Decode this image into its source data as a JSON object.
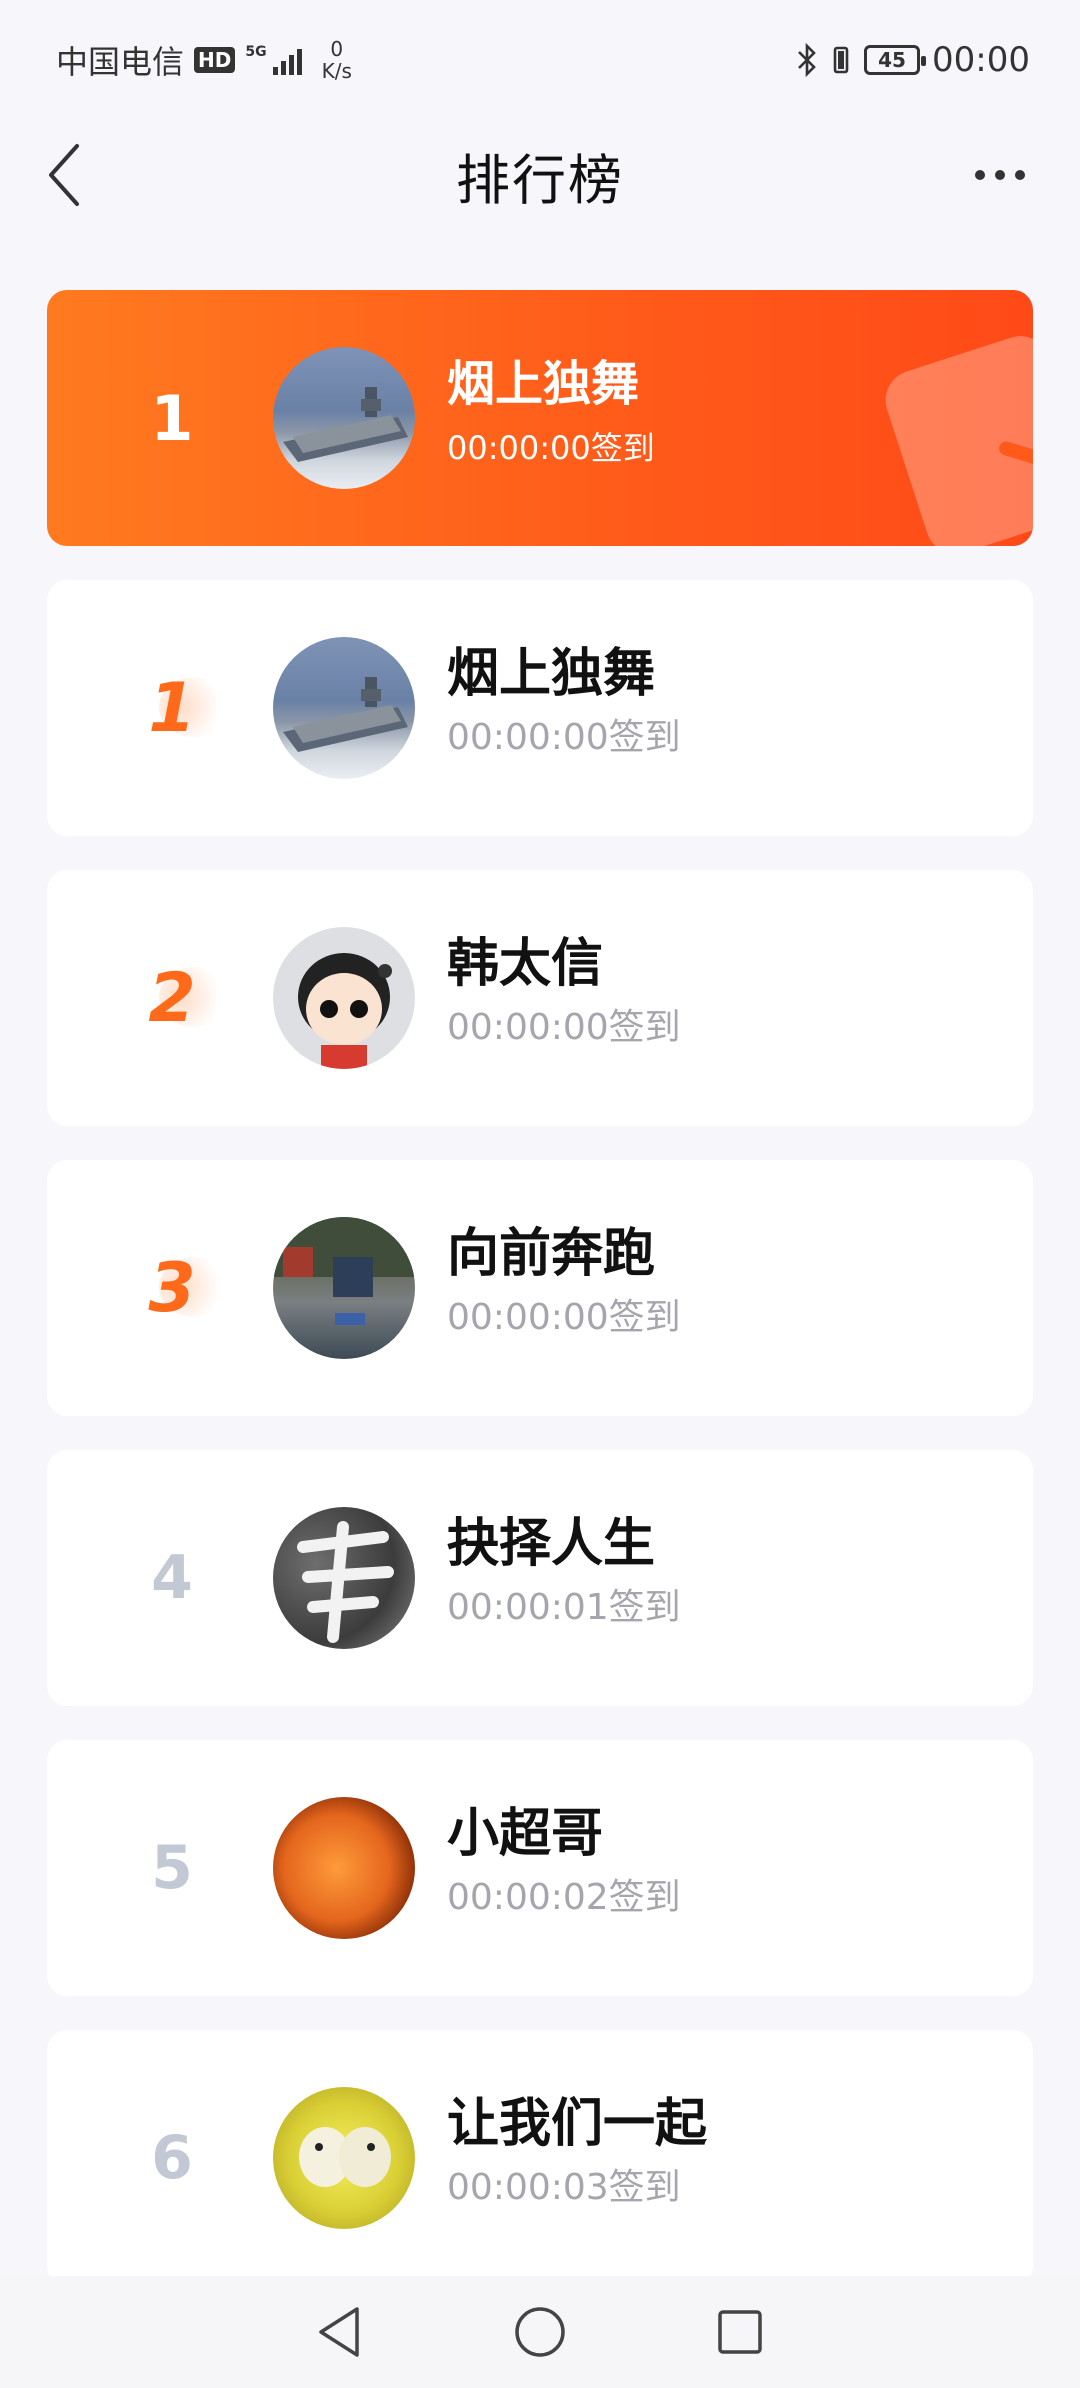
{
  "status_bar": {
    "carrier": "中国电信",
    "hd": "HD",
    "network": "5G",
    "speed_value": "0",
    "speed_unit": "K/s",
    "battery": "45",
    "time": "00:00"
  },
  "header": {
    "title": "排行榜"
  },
  "featured": {
    "rank": "1",
    "name": "烟上独舞",
    "time": "00:00:00签到",
    "avatar": "aircraft-carrier-avatar"
  },
  "ranking": [
    {
      "rank": "1",
      "name": "烟上独舞",
      "time": "00:00:00签到",
      "avatar": "aircraft-carrier-avatar"
    },
    {
      "rank": "2",
      "name": "韩太信",
      "time": "00:00:00签到",
      "avatar": "cartoon-girl-avatar"
    },
    {
      "rank": "3",
      "name": "向前奔跑",
      "time": "00:00:00签到",
      "avatar": "street-scene-avatar"
    },
    {
      "rank": "4",
      "name": "抉择人生",
      "time": "00:00:01签到",
      "avatar": "calligraphy-avatar"
    },
    {
      "rank": "5",
      "name": "小超哥",
      "time": "00:00:02签到",
      "avatar": "orange-texture-avatar"
    },
    {
      "rank": "6",
      "name": "让我们一起",
      "time": "00:00:03签到",
      "avatar": "two-birds-avatar"
    }
  ],
  "colors": {
    "accent": "#ff5a1a",
    "medal": "#ff6a1a",
    "rank_gray": "#c2c8d4",
    "secondary_text": "#a5a5ad",
    "background": "#f6f6fb"
  }
}
